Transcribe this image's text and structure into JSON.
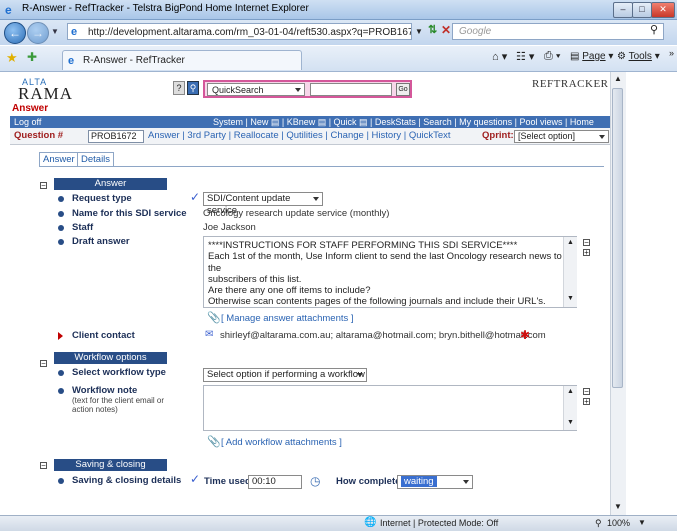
{
  "window": {
    "title": "R-Answer - RefTracker - Telstra BigPond Home Internet Explorer",
    "url": "http://development.altarama.com/rm_03-01-04/reft530.aspx?q=PROB1672&fid=",
    "search_placeholder": "Google",
    "tab_title": "R-Answer - RefTracker",
    "toolbar": {
      "page": "Page",
      "tools": "Tools"
    }
  },
  "status": {
    "zone": "Internet | Protected Mode: Off",
    "zoom": "100%"
  },
  "header": {
    "logo_top": "ALTA",
    "logo_bottom": "RAMA",
    "page_label": "Answer",
    "brand": "REFTRACKER",
    "quicksearch_selected": "QuickSearch",
    "go_label": "Go"
  },
  "navbar": {
    "logoff": "Log off",
    "links": "System | New ▤ | KBnew ▤ | Quick ▤ | DeskStats | Search | My questions | Pool views | Home"
  },
  "question_bar": {
    "label": "Question #",
    "number": "PROB1672",
    "links": "Answer | 3rd Party | Reallocate | Qutilities | Change | History | QuickText",
    "qprint_label": "Qprint:",
    "qprint_value": "[Select option]"
  },
  "tabs": [
    "Answer",
    "Details"
  ],
  "answer_section": {
    "header": "Answer",
    "request_type_label": "Request type",
    "request_type_value": "SDI/Content update service",
    "sdi_name_label": "Name for this SDI service",
    "sdi_name_value": "Oncology research update service (monthly)",
    "staff_label": "Staff",
    "staff_value": "Joe Jackson",
    "draft_label": "Draft answer",
    "draft_lines": [
      "****INSTRUCTIONS FOR STAFF PERFORMING THIS SDI SERVICE****",
      "Each 1st of the month, Use Inform client to send the last Oncology research news to the",
      "subscribers of this list.",
      "Are there any one off items to include?",
      "Otherwise  scan contents pages of the following journals and include their URL's.",
      "*************************************************************************************"
    ],
    "manage_attachments": "[ Manage answer attachments ]",
    "client_contact_label": "Client contact",
    "client_contact_value": "shirleyf@altarama.com.au; altarama@hotmail.com; bryn.bithell@hotmail.com"
  },
  "workflow_section": {
    "header": "Workflow options",
    "type_label": "Select workflow type",
    "type_value": "Select option if performing a workflow",
    "note_label": "Workflow note",
    "note_sublabel": "(text for the client email or action notes)",
    "add_attachments": "[ Add workflow attachments ]"
  },
  "closing_section": {
    "header": "Saving & closing",
    "details_label": "Saving & closing details",
    "time_used_label": "Time used",
    "time_used_value": "00:10",
    "how_complete_label": "How complete",
    "how_complete_value": "waiting"
  }
}
